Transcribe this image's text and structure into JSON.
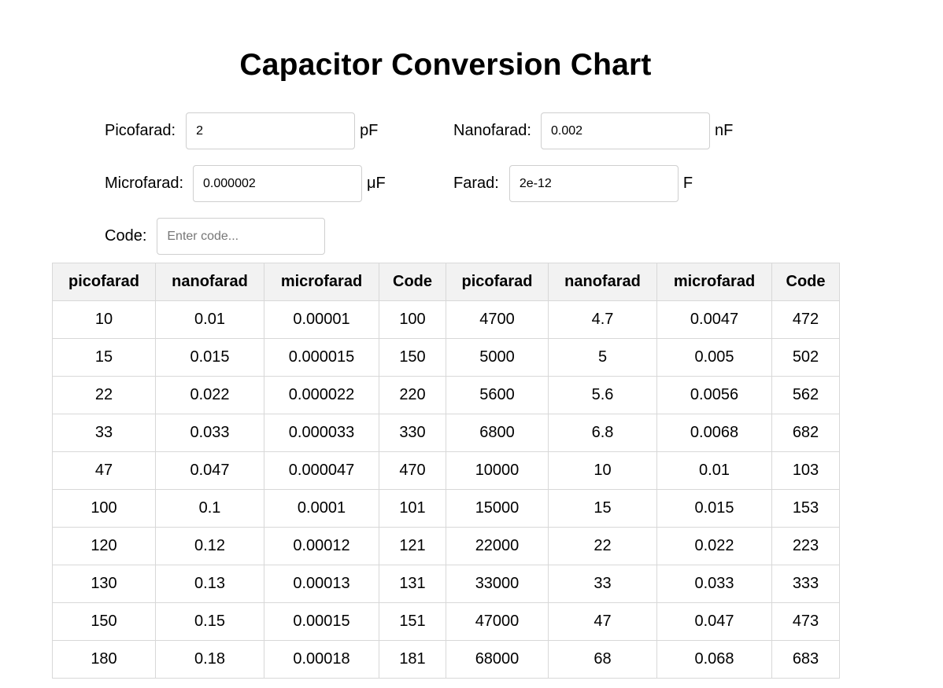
{
  "page_title": "Capacitor Conversion Chart",
  "fields": {
    "picofarad": {
      "label": "Picofarad:",
      "value": "2",
      "unit": "pF"
    },
    "nanofarad": {
      "label": "Nanofarad:",
      "value": "0.002",
      "unit": "nF"
    },
    "microfarad": {
      "label": "Microfarad:",
      "value": "0.000002",
      "unit": "μF"
    },
    "farad": {
      "label": "Farad:",
      "value": "2e-12",
      "unit": "F"
    },
    "code": {
      "label": "Code:",
      "value": "",
      "placeholder": "Enter code..."
    }
  },
  "table": {
    "headers": [
      "picofarad",
      "nanofarad",
      "microfarad",
      "Code",
      "picofarad",
      "nanofarad",
      "microfarad",
      "Code"
    ],
    "rows": [
      [
        "10",
        "0.01",
        "0.00001",
        "100",
        "4700",
        "4.7",
        "0.0047",
        "472"
      ],
      [
        "15",
        "0.015",
        "0.000015",
        "150",
        "5000",
        "5",
        "0.005",
        "502"
      ],
      [
        "22",
        "0.022",
        "0.000022",
        "220",
        "5600",
        "5.6",
        "0.0056",
        "562"
      ],
      [
        "33",
        "0.033",
        "0.000033",
        "330",
        "6800",
        "6.8",
        "0.0068",
        "682"
      ],
      [
        "47",
        "0.047",
        "0.000047",
        "470",
        "10000",
        "10",
        "0.01",
        "103"
      ],
      [
        "100",
        "0.1",
        "0.0001",
        "101",
        "15000",
        "15",
        "0.015",
        "153"
      ],
      [
        "120",
        "0.12",
        "0.00012",
        "121",
        "22000",
        "22",
        "0.022",
        "223"
      ],
      [
        "130",
        "0.13",
        "0.00013",
        "131",
        "33000",
        "33",
        "0.033",
        "333"
      ],
      [
        "150",
        "0.15",
        "0.00015",
        "151",
        "47000",
        "47",
        "0.047",
        "473"
      ],
      [
        "180",
        "0.18",
        "0.00018",
        "181",
        "68000",
        "68",
        "0.068",
        "683"
      ]
    ]
  }
}
